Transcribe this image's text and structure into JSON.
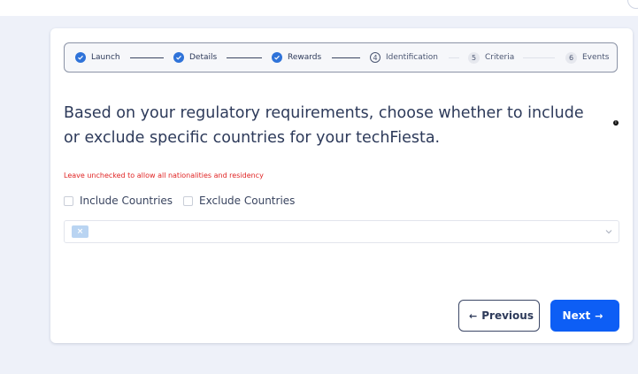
{
  "stepper": {
    "steps": [
      {
        "label": "Launch",
        "state": "done"
      },
      {
        "label": "Details",
        "state": "done"
      },
      {
        "label": "Rewards",
        "state": "done"
      },
      {
        "label": "Identification",
        "state": "current",
        "number": "4"
      },
      {
        "label": "Criteria",
        "state": "todo",
        "number": "5"
      },
      {
        "label": "Events",
        "state": "todo",
        "number": "6"
      }
    ]
  },
  "main": {
    "heading": "Based on your regulatory requirements, choose whether to include or exclude specific countries for your techFiesta.",
    "info_icon": "i",
    "hint": "Leave unchecked to allow all nationalities and residency",
    "include_label": "Include Countries",
    "exclude_label": "Exclude Countries",
    "country_select": {
      "tag_remove": "×"
    }
  },
  "actions": {
    "previous_label": "Previous",
    "next_label": "Next"
  },
  "colors": {
    "accent": "#0d5ef5",
    "step_done": "#2f73d9",
    "hint": "#e02424",
    "background": "#eef1f9"
  }
}
